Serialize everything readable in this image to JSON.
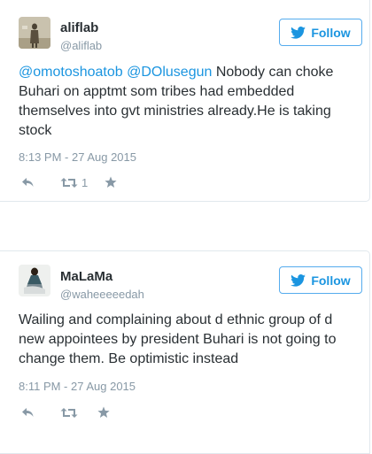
{
  "tweets": [
    {
      "name": "aliflab",
      "handle": "@aliflab",
      "follow_label": "Follow",
      "mentions": [
        "@omotoshoatob",
        "@DOlusegun"
      ],
      "text": " Nobody can choke Buhari on apptmt som tribes had embedded themselves into gvt ministries already.He is taking stock",
      "timestamp": "8:13 PM - 27 Aug 2015",
      "retweet_count": "1",
      "icons": [
        "reply-icon",
        "retweet-icon",
        "favorite-icon"
      ]
    },
    {
      "name": "MaLaMa",
      "handle": "@waheeeeedah",
      "follow_label": "Follow",
      "text": "Wailing and complaining about d ethnic group of d new appointees by president Buhari is not going to change them. Be optimistic instead",
      "timestamp": "8:11 PM - 27 Aug 2015",
      "icons": [
        "reply-icon",
        "retweet-icon",
        "favorite-icon"
      ]
    }
  ],
  "colors": {
    "link": "#1b95e0",
    "follow_border": "#55acee",
    "text": "#292f33",
    "muted": "#8899a6",
    "border": "#e1e8ed"
  }
}
